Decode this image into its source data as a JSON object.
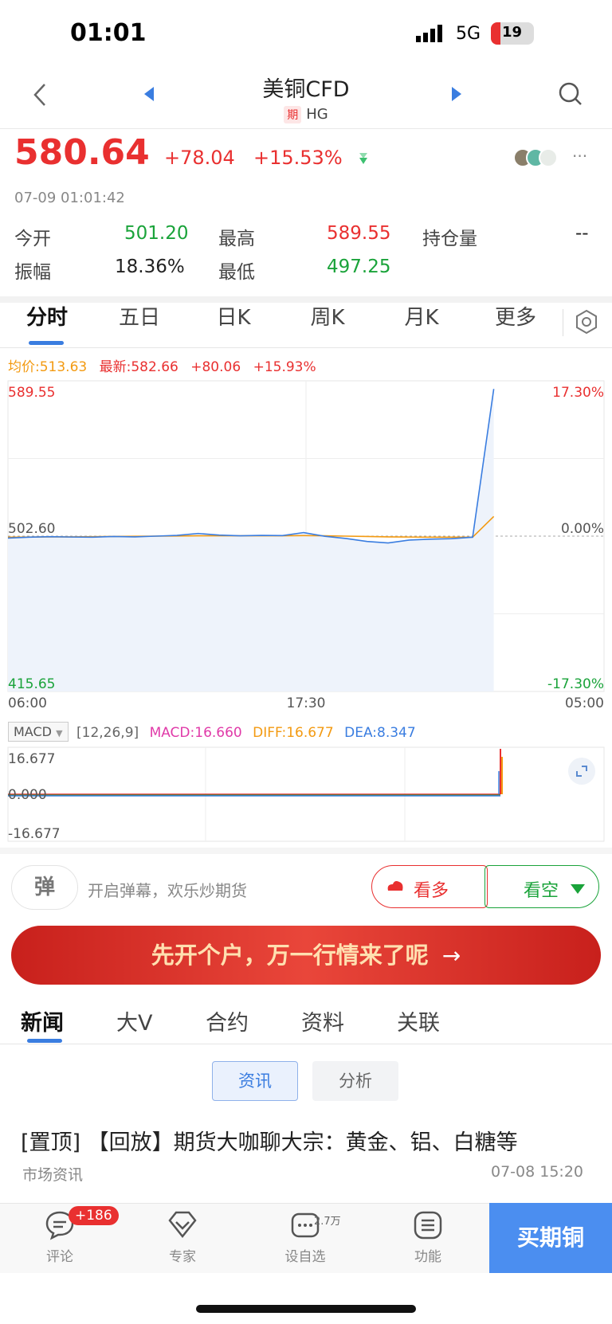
{
  "status_bar": {
    "time": "01:01",
    "network": "5G",
    "battery": "19"
  },
  "nav": {
    "title": "美铜CFD",
    "badge": "期",
    "code": "HG"
  },
  "quote": {
    "price": "580.64",
    "change": "+78.04",
    "change_pct": "+15.53%",
    "timestamp": "07-09 01:01:42",
    "open_label": "今开",
    "open": "501.20",
    "high_label": "最高",
    "high": "589.55",
    "oi_label": "持仓量",
    "oi": "--",
    "amp_label": "振幅",
    "amp": "18.36%",
    "low_label": "最低",
    "low": "497.25",
    "more": "···"
  },
  "chart_tabs": [
    "分时",
    "五日",
    "日K",
    "周K",
    "月K",
    "更多"
  ],
  "chart_info": {
    "avg": "均价:513.63",
    "latest": "最新:582.66",
    "change": "+80.06",
    "pct": "+15.93%"
  },
  "chart_data": {
    "type": "line",
    "y_left_ticks": [
      "589.55",
      "502.60",
      "415.65"
    ],
    "y_right_ticks": [
      "17.30%",
      "0.00%",
      "-17.30%"
    ],
    "x_ticks": [
      "06:00",
      "17:30",
      "05:00"
    ],
    "ylim": [
      415.65,
      589.55
    ],
    "series": [
      {
        "values": [
          501.5,
          502.0,
          502.3,
          502.1,
          502.0,
          502.4,
          502.2,
          502.6,
          503.0,
          504.1,
          503.2,
          502.8,
          503.0,
          502.9,
          504.6,
          502.5,
          501.3,
          499.6,
          498.8,
          500.4,
          500.9,
          501.2,
          502.0,
          585.0
        ]
      },
      {
        "values": [
          502.0,
          502.1,
          502.2,
          502.2,
          502.3,
          502.4,
          502.5,
          502.6,
          502.7,
          502.8,
          502.8,
          502.8,
          502.8,
          502.8,
          502.9,
          502.8,
          502.6,
          502.4,
          502.2,
          502.1,
          502.0,
          502.0,
          502.0,
          513.6
        ]
      }
    ],
    "grid": true
  },
  "macd": {
    "selector": "MACD",
    "params": "[12,26,9]",
    "macd": "MACD:16.660",
    "diff": "DIFF:16.677",
    "dea": "DEA:8.347",
    "ticks": [
      "16.677",
      "0.000",
      "-16.677"
    ]
  },
  "danmaku": {
    "icon_text": "弹",
    "placeholder": "开启弹幕，欢乐炒期货"
  },
  "sentiment": {
    "bull": "看多",
    "bear": "看空"
  },
  "banner": {
    "text": "先开个户，万一行情来了呢"
  },
  "news_tabs": [
    "新闻",
    "大V",
    "合约",
    "资料",
    "关联"
  ],
  "sub_tabs": [
    "资讯",
    "分析"
  ],
  "news": [
    {
      "title": "[置顶] 【回放】期货大咖聊大宗：黄金、铝、白糖等",
      "source": "市场资讯",
      "time": "07-08 15:20"
    }
  ],
  "bottom_bar": {
    "comment": "评论",
    "comment_badge": "+186",
    "expert": "专家",
    "watch": "设自选",
    "watch_count": "2.7万",
    "func": "功能",
    "buy": "买期铜"
  },
  "colors": {
    "red": "#e93030",
    "green": "#1aa33a",
    "blue": "#3a7de0",
    "orange": "#f39a11",
    "pink": "#e03aa8"
  }
}
